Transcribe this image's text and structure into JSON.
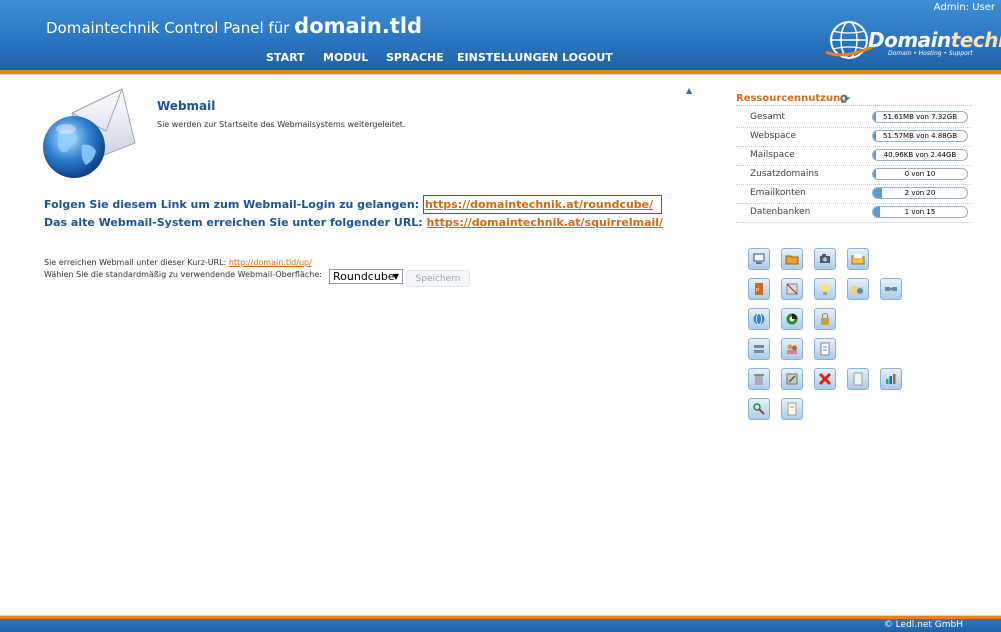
{
  "header": {
    "title_prefix": "Domaintechnik Control Panel für",
    "title_domain": "domain.tld",
    "admin": "Admin: User",
    "nav": [
      "START",
      "MODUL",
      "SPRACHE",
      "EINSTELLUNGEN",
      "LOGOUT"
    ],
    "logo": {
      "brand_a": "Domain",
      "brand_b": "technik",
      "tagline": "Domain • Hosting • Support"
    }
  },
  "main": {
    "title": "Webmail",
    "description": "Sie werden zur Startseite des Webmailsystems weitergeleitet.",
    "line1_text": "Folgen Sie diesem Link um zum Webmail-Login zu gelangen:",
    "line1_link": "https://domaintechnik.at/roundcube/",
    "line2_text": "Das alte Webmail-System erreichen Sie unter folgender URL:",
    "line2_link": "https://domaintechnik.at/squirrelmail/",
    "short_url_text": "Sie erreichen Webmail unter dieser Kurz-URL:",
    "short_url_link": "http://domain.tld/up/",
    "default_text": "Wählen Sie die standardmäßig zu verwendende Webmail-Oberfläche:",
    "select_value": "Roundcube",
    "save_label": "Speichern"
  },
  "resources": {
    "title": "Ressourcennutzung",
    "items": [
      {
        "label": "Gesamt",
        "value": "51.61MB von 7.32GB",
        "fraction": 0.01
      },
      {
        "label": "Webspace",
        "value": "51.57MB von 4.88GB",
        "fraction": 0.01
      },
      {
        "label": "Mailspace",
        "value": "40.96KB von 2.44GB",
        "fraction": 0.0
      },
      {
        "label": "Zusatzdomains",
        "value": "0 von 10",
        "fraction": 0.0
      },
      {
        "label": "Emailkonten",
        "value": "2 von 20",
        "fraction": 0.1
      },
      {
        "label": "Datenbanken",
        "value": "1 von 15",
        "fraction": 0.07
      }
    ]
  },
  "tool_icons": [
    [
      "computer-icon",
      "folder-icon",
      "camera-icon",
      "open-folder-icon"
    ],
    [
      "pdf-icon",
      "no-image-icon",
      "lightbulb-icon",
      "folder-globe-icon",
      "network-icon"
    ],
    [
      "globe-icon",
      "color-wheel-icon",
      "lock-icon"
    ],
    [
      "servers-icon",
      "people-icon",
      "document-icon"
    ],
    [
      "trash-icon",
      "tools-icon",
      "delete-x-icon",
      "page-icon",
      "bar-chart-icon"
    ],
    [
      "search-users-icon",
      "notes-icon"
    ]
  ],
  "footer": {
    "copyright": "© Ledl.net GmbH"
  },
  "colors": {
    "header_blue": "#2b76c2",
    "accent_orange": "#e8821c",
    "title_blue": "#1c5593",
    "link_orange": "#d66a10"
  }
}
